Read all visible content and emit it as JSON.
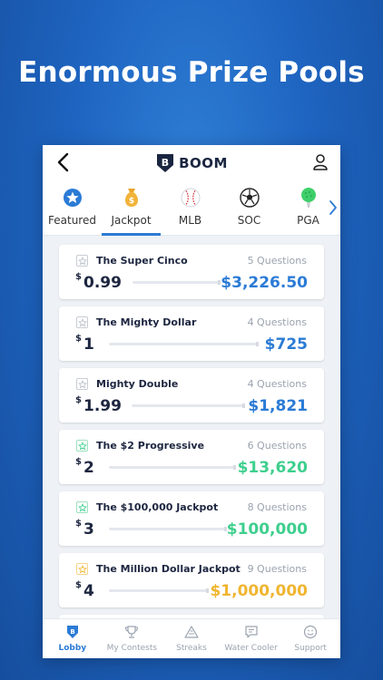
{
  "headline": "Enormous Prize Pools",
  "app": {
    "logo_text": "BOOM"
  },
  "tabs": [
    {
      "label": "Featured",
      "icon": "star-badge-icon"
    },
    {
      "label": "Jackpot",
      "icon": "money-bag-icon",
      "active": true
    },
    {
      "label": "MLB",
      "icon": "baseball-icon"
    },
    {
      "label": "SOC",
      "icon": "soccer-ball-icon"
    },
    {
      "label": "PGA",
      "icon": "golf-ball-icon"
    }
  ],
  "contests": [
    {
      "name": "The Super Cinco",
      "questions": "5 Questions",
      "currency": "$",
      "price": "0.99",
      "prize": "$3,226.50",
      "prize_color": "#2b7bd6"
    },
    {
      "name": "The Mighty Dollar",
      "questions": "4 Questions",
      "currency": "$",
      "price": "1",
      "prize": "$725",
      "prize_color": "#2b7bd6"
    },
    {
      "name": "Mighty Double",
      "questions": "4 Questions",
      "currency": "$",
      "price": "1.99",
      "prize": "$1,821",
      "prize_color": "#2b7bd6"
    },
    {
      "name": "The $2 Progressive",
      "questions": "6 Questions",
      "currency": "$",
      "price": "2",
      "prize": "$13,620",
      "prize_color": "#3ecf8e"
    },
    {
      "name": "The $100,000 Jackpot",
      "questions": "8 Questions",
      "currency": "$",
      "price": "3",
      "prize": "$100,000",
      "prize_color": "#3ecf8e"
    },
    {
      "name": "The Million Dollar Jackpot",
      "questions": "9 Questions",
      "currency": "$",
      "price": "4",
      "prize": "$1,000,000",
      "prize_color": "#f0b531"
    }
  ],
  "bottom_nav": [
    {
      "label": "Lobby",
      "icon": "boom-shield-icon",
      "active": true
    },
    {
      "label": "My Contests",
      "icon": "trophy-icon"
    },
    {
      "label": "Streaks",
      "icon": "triangle-icon"
    },
    {
      "label": "Water Cooler",
      "icon": "chat-bubble-icon"
    },
    {
      "label": "Support",
      "icon": "smiley-icon"
    }
  ],
  "colors": {
    "accent": "#2b7bd6",
    "background": "#1e64c0",
    "green": "#3ecf8e",
    "gold": "#f0b531"
  }
}
